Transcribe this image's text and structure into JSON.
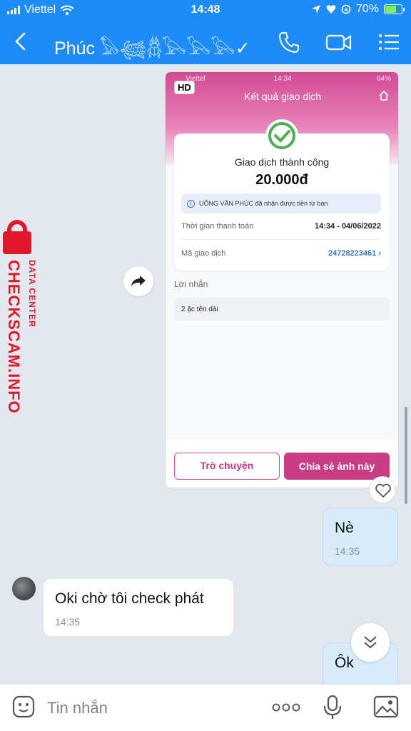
{
  "status_bar": {
    "carrier": "Viettel",
    "time": "14:48",
    "battery": "70%",
    "battery_level": 0.7
  },
  "header": {
    "contact_name": "Phúc 𓅃𓆉𓆣𓅂𓅂𓅂✓",
    "icons": [
      "back-icon",
      "phone-icon",
      "video-call-icon",
      "menu-icon"
    ]
  },
  "image_message": {
    "hd_badge": "HD",
    "inner_status": {
      "carrier": "Viettel",
      "time": "14:34",
      "battery": "64%"
    },
    "screen_title": "Kết quả giao dịch",
    "success_text": "Giao dịch thành công",
    "amount": "20.000đ",
    "notice": "UÔNG VĂN PHÚC đã nhận được tiền từ bạn",
    "rows": [
      {
        "label": "Thời gian thanh toán",
        "value": "14:34 - 04/06/2022"
      },
      {
        "label": "Mã giao dịch",
        "value": "24728223461"
      }
    ],
    "message_label": "Lời nhắn",
    "message_text": "2 ặc tên dài",
    "btn_chat": "Trò chuyện",
    "btn_share": "Chia sẻ ảnh này"
  },
  "messages": [
    {
      "from": "me",
      "text": "Nè",
      "time": "14:35"
    },
    {
      "from": "other",
      "text": "Oki chờ tôi check phát",
      "time": "14:35"
    },
    {
      "from": "me",
      "text": "Ôk"
    }
  ],
  "watermark": {
    "main": "CHECKSCAM.INFO",
    "sub": "DATA CENTER"
  },
  "input": {
    "placeholder": "Tin nhắn"
  },
  "colors": {
    "header_blue": "#1d8cf8",
    "accent_pink": "#c83d86",
    "watermark_red": "#e0182a"
  }
}
